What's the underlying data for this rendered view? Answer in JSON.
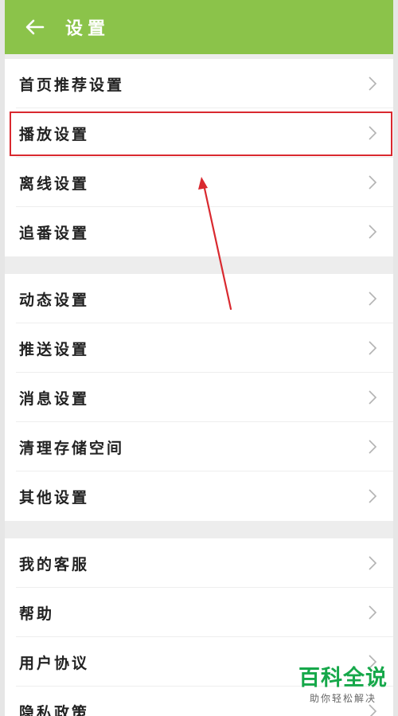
{
  "header": {
    "title": "设置",
    "back_icon": "arrow-left-icon"
  },
  "groups": [
    {
      "items": [
        "首页推荐设置",
        "播放设置",
        "离线设置",
        "追番设置"
      ]
    },
    {
      "items": [
        "动态设置",
        "推送设置",
        "消息设置",
        "清理存储空间",
        "其他设置"
      ]
    },
    {
      "items": [
        "我的客服",
        "帮助",
        "用户协议",
        "隐私政策"
      ]
    }
  ],
  "annotation": {
    "highlighted_item": "播放设置",
    "color": "#d9292f"
  },
  "watermark": {
    "main": "百科全说",
    "sub": "助你轻松解决",
    "color": "#16a84a"
  },
  "colors": {
    "header_bg": "#8bc34a",
    "page_bg": "#ededed"
  }
}
